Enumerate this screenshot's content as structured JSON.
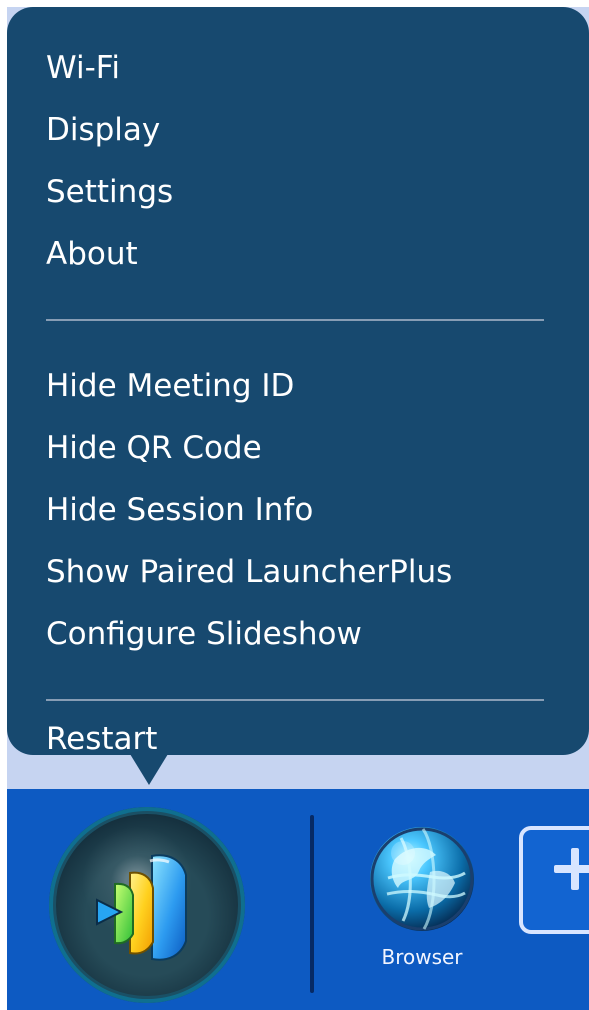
{
  "menu": {
    "items": [
      {
        "label": "Wi-Fi"
      },
      {
        "label": "Display"
      },
      {
        "label": "Settings"
      },
      {
        "label": "About"
      },
      {
        "label": "Hide Meeting ID"
      },
      {
        "label": "Hide QR Code"
      },
      {
        "label": "Hide Session Info"
      },
      {
        "label": "Show Paired LauncherPlus"
      },
      {
        "label": "Configure Slideshow"
      },
      {
        "label": "Restart"
      }
    ]
  },
  "taskbar": {
    "apps": [
      {
        "label": "Browser",
        "icon": "globe-icon"
      }
    ],
    "launcher_icon": "launcher-icon",
    "add_icon": "plus-icon"
  },
  "colors": {
    "menu_background": "#17496f",
    "divider": "#8da2b8",
    "backdrop": "#c6d4f1",
    "taskbar": "#0d5ac2",
    "text": "#ffffff"
  }
}
